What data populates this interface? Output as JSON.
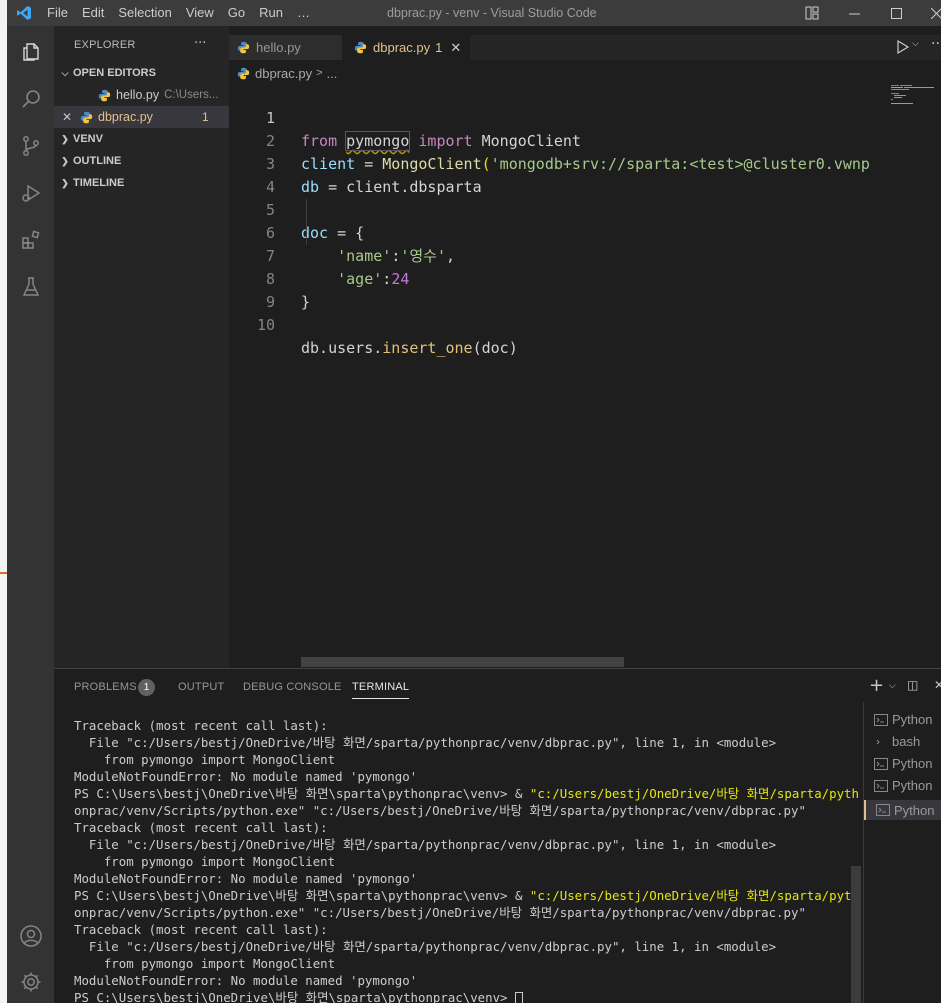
{
  "window": {
    "title": "dbprac.py - venv - Visual Studio Code",
    "menu": [
      "File",
      "Edit",
      "Selection",
      "View",
      "Go",
      "Run",
      "…"
    ]
  },
  "sidebar": {
    "title": "EXPLORER",
    "title_more": "···",
    "open_editors_label": "OPEN EDITORS",
    "open_editors": [
      {
        "name": "hello.py",
        "path": "C:\\Users..."
      },
      {
        "name": "dbprac.py",
        "problems": "1"
      }
    ],
    "sections": [
      "VENV",
      "OUTLINE",
      "TIMELINE"
    ]
  },
  "tabs": [
    {
      "label": "hello.py"
    },
    {
      "label": "dbprac.py",
      "problems": "1"
    }
  ],
  "breadcrumb": {
    "file": "dbprac.py",
    "sep": ">",
    "more": "..."
  },
  "editor": {
    "line_numbers": [
      "1",
      "2",
      "3",
      "4",
      "5",
      "6",
      "7",
      "8",
      "9",
      "10"
    ],
    "tokens": {
      "l1_from": "from",
      "l1_module": "pymongo",
      "l1_import": "import",
      "l1_class": "MongoClient",
      "l2_var": "client",
      "l2_eq": " = ",
      "l2_fn": "MongoClient",
      "l2_paren": "(",
      "l2_str": "'mongodb+srv://sparta:<test>@cluster0.vwnp",
      "l3_var": "db",
      "l3_rest": " = client.dbsparta",
      "l5_var": "doc",
      "l5_rest": " = {",
      "l6_key": "'name'",
      "l6_colon": ":",
      "l6_val": "'영수'",
      "l6_comma": ",",
      "l7_key": "'age'",
      "l7_colon": ":",
      "l7_val": "24",
      "l8_close": "}",
      "l10_a": "db.users.",
      "l10_fn": "insert_one",
      "l10_b": "(doc)"
    }
  },
  "panel": {
    "tabs": [
      "PROBLEMS",
      "OUTPUT",
      "DEBUG CONSOLE",
      "TERMINAL"
    ],
    "problems_count": "1",
    "add_icon": "+",
    "terminal_lines": [
      "Traceback (most recent call last):",
      "  File \"c:/Users/bestj/OneDrive/바탕 화면/sparta/pythonprac/venv/dbprac.py\", line 1, in <module>",
      "    from pymongo import MongoClient",
      "ModuleNotFoundError: No module named 'pymongo'",
      "PS C:\\Users\\bestj\\OneDrive\\바탕 화면\\sparta\\pythonprac\\venv> & ",
      "onprac/venv/Scripts/python.exe\" \"c:/Users/bestj/OneDrive/바탕 화면/sparta/pythonprac/venv/dbprac.py\"",
      "Traceback (most recent call last):",
      "  File \"c:/Users/bestj/OneDrive/바탕 화면/sparta/pythonprac/venv/dbprac.py\", line 1, in <module>",
      "    from pymongo import MongoClient",
      "ModuleNotFoundError: No module named 'pymongo'",
      "PS C:\\Users\\bestj\\OneDrive\\바탕 화면\\sparta\\pythonprac\\venv> & ",
      "onprac/venv/Scripts/python.exe\" \"c:/Users/bestj/OneDrive/바탕 화면/sparta/pythonprac/venv/dbprac.py\"",
      "Traceback (most recent call last):",
      "  File \"c:/Users/bestj/OneDrive/바탕 화면/sparta/pythonprac/venv/dbprac.py\", line 1, in <module>",
      "    from pymongo import MongoClient",
      "ModuleNotFoundError: No module named 'pymongo'",
      "PS C:\\Users\\bestj\\OneDrive\\바탕 화면\\sparta\\pythonprac\\venv> "
    ],
    "cmd_part": "\"c:/Users/bestj/OneDrive/바탕 화면/sparta/pyth",
    "terminals": [
      "Python",
      "bash",
      "Python",
      "Python",
      "Python"
    ]
  },
  "colors": {
    "accent": "#007acc",
    "modified": "#e2c08d"
  }
}
